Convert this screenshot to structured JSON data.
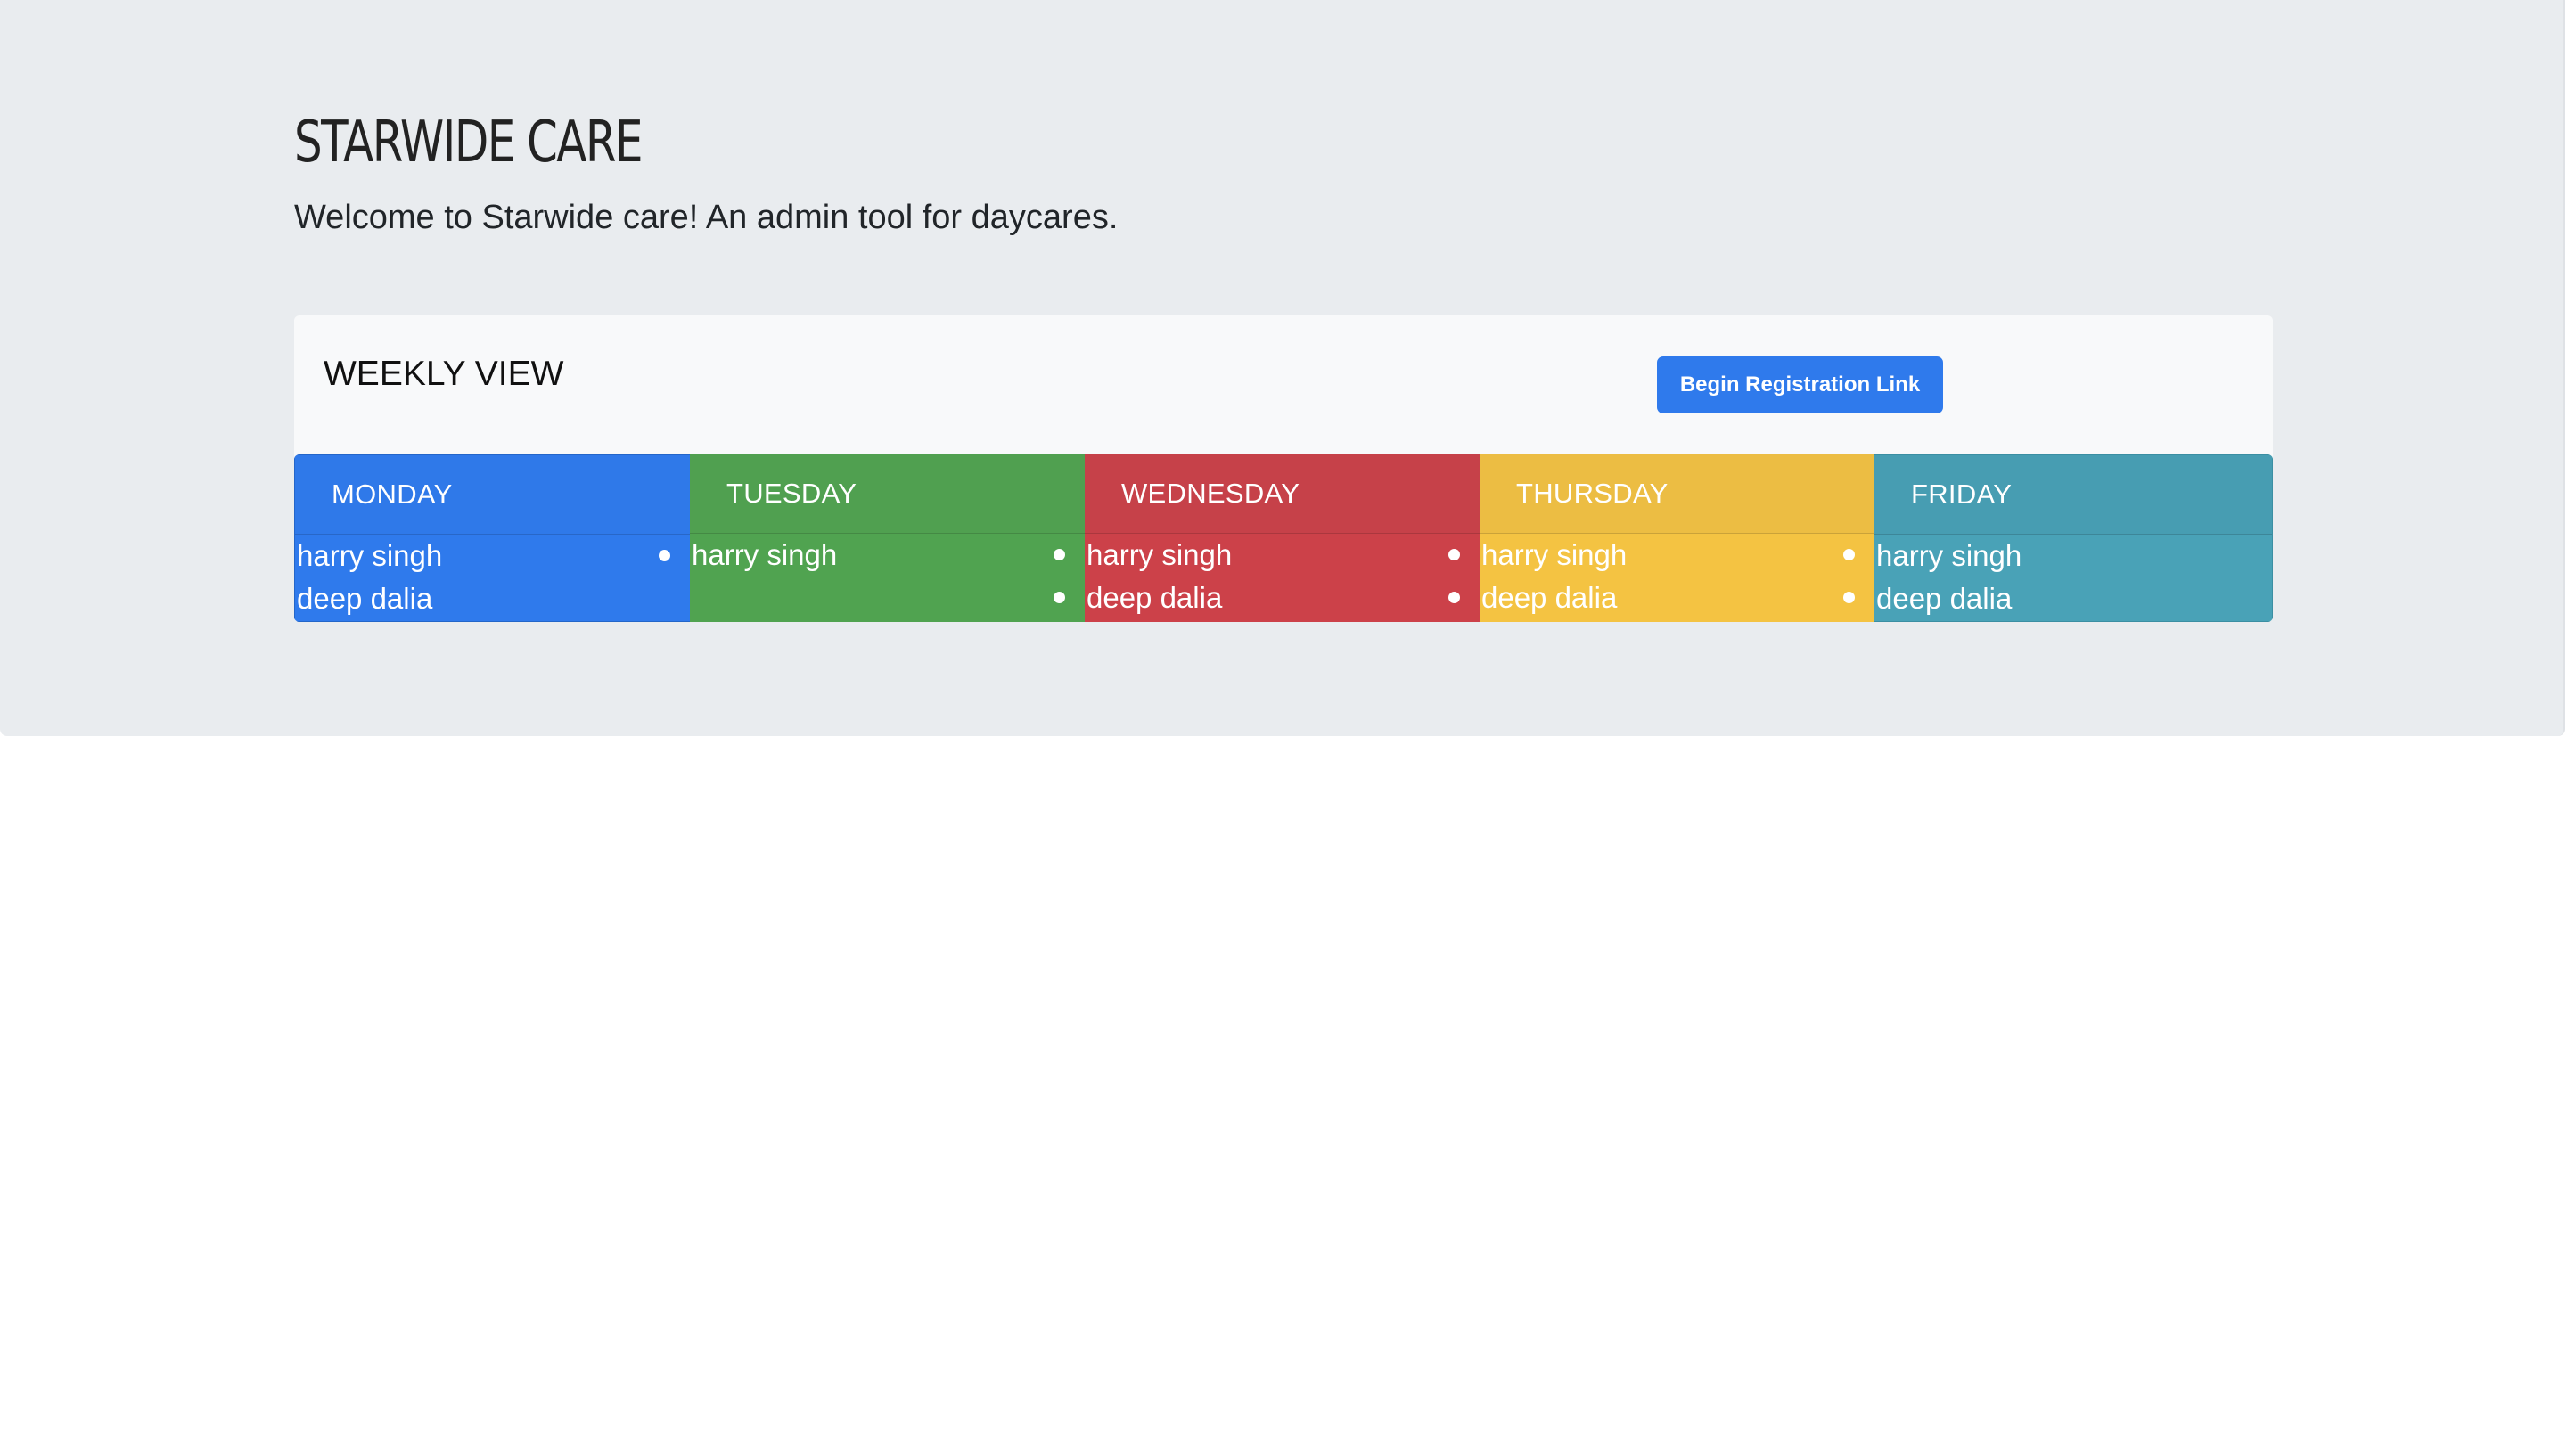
{
  "header": {
    "title": "STARWIDE CARE",
    "subtitle": "Welcome to Starwide care! An admin tool for daycares."
  },
  "card": {
    "title": "WEEKLY VIEW",
    "button_label": "Begin Registration Link"
  },
  "week": {
    "days": [
      {
        "name": "MONDAY",
        "color": "#2f7aec",
        "items": [
          "harry singh",
          "deep dalia"
        ]
      },
      {
        "name": "TUESDAY",
        "color": "#50a350",
        "items": [
          "harry singh"
        ]
      },
      {
        "name": "WEDNESDAY",
        "color": "#cc4149",
        "items": [
          "harry singh",
          "deep dalia"
        ]
      },
      {
        "name": "THURSDAY",
        "color": "#f4c342",
        "items": [
          "harry singh",
          "deep dalia"
        ]
      },
      {
        "name": "FRIDAY",
        "color": "#49a2b7",
        "items": [
          "harry singh",
          "deep dalia"
        ]
      }
    ]
  }
}
